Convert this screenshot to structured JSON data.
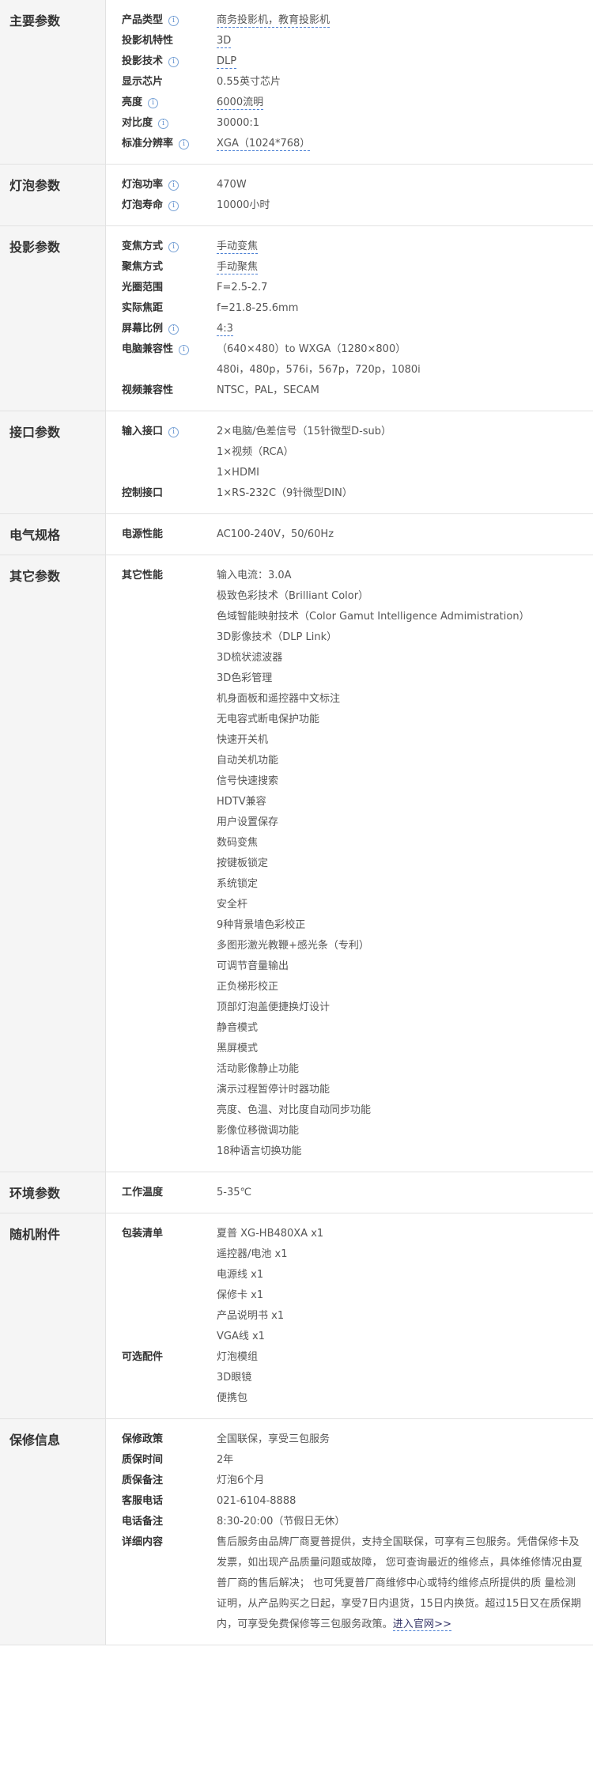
{
  "info_glyph": "i",
  "sections": [
    {
      "title": "主要参数",
      "rows": [
        {
          "label": "产品类型",
          "info": true,
          "values": [
            {
              "text": "商务投影机，教育投影机",
              "link": true
            }
          ]
        },
        {
          "label": "投影机特性",
          "info": false,
          "values": [
            {
              "text": "3D",
              "link": true
            }
          ]
        },
        {
          "label": "投影技术",
          "info": true,
          "values": [
            {
              "text": "DLP",
              "link": true
            }
          ]
        },
        {
          "label": "显示芯片",
          "info": false,
          "values": [
            {
              "text": "0.55英寸芯片",
              "link": false
            }
          ]
        },
        {
          "label": "亮度",
          "info": true,
          "values": [
            {
              "text": "6000流明",
              "link": true
            }
          ]
        },
        {
          "label": "对比度",
          "info": true,
          "values": [
            {
              "text": "30000:1",
              "link": false
            }
          ]
        },
        {
          "label": "标准分辨率",
          "info": true,
          "values": [
            {
              "text": "XGA（1024*768）",
              "link": true
            }
          ]
        }
      ]
    },
    {
      "title": "灯泡参数",
      "rows": [
        {
          "label": "灯泡功率",
          "info": true,
          "values": [
            {
              "text": "470W",
              "link": false
            }
          ]
        },
        {
          "label": "灯泡寿命",
          "info": true,
          "values": [
            {
              "text": "10000小时",
              "link": false
            }
          ]
        }
      ]
    },
    {
      "title": "投影参数",
      "rows": [
        {
          "label": "变焦方式",
          "info": true,
          "values": [
            {
              "text": "手动变焦",
              "link": true
            }
          ]
        },
        {
          "label": "聚焦方式",
          "info": false,
          "values": [
            {
              "text": "手动聚焦",
              "link": true
            }
          ]
        },
        {
          "label": "光圈范围",
          "info": false,
          "values": [
            {
              "text": "F=2.5-2.7",
              "link": false
            }
          ]
        },
        {
          "label": "实际焦距",
          "info": false,
          "values": [
            {
              "text": "f=21.8-25.6mm",
              "link": false
            }
          ]
        },
        {
          "label": "屏幕比例",
          "info": true,
          "values": [
            {
              "text": "4:3",
              "link": true
            }
          ]
        },
        {
          "label": "电脑兼容性",
          "info": true,
          "values": [
            {
              "text": "（640×480）to WXGA（1280×800）",
              "link": false
            },
            {
              "text": "480i，480p，576i，567p，720p，1080i",
              "link": false
            }
          ]
        },
        {
          "label": "视频兼容性",
          "info": false,
          "values": [
            {
              "text": "NTSC，PAL，SECAM",
              "link": false
            }
          ]
        }
      ]
    },
    {
      "title": "接口参数",
      "rows": [
        {
          "label": "输入接口",
          "info": true,
          "values": [
            {
              "text": "2×电脑/色差信号（15针微型D-sub）",
              "link": false
            },
            {
              "text": "1×视频（RCA）",
              "link": false
            },
            {
              "text": "1×HDMI",
              "link": false
            }
          ]
        },
        {
          "label": "控制接口",
          "info": false,
          "values": [
            {
              "text": "1×RS-232C（9针微型DIN）",
              "link": false
            }
          ]
        }
      ]
    },
    {
      "title": "电气规格",
      "rows": [
        {
          "label": "电源性能",
          "info": false,
          "values": [
            {
              "text": "AC100-240V，50/60Hz",
              "link": false
            }
          ]
        }
      ]
    },
    {
      "title": "其它参数",
      "rows": [
        {
          "label": "其它性能",
          "info": false,
          "values": [
            {
              "text": "输入电流：3.0A",
              "link": false
            },
            {
              "text": "极致色彩技术（Brilliant Color）",
              "link": false
            },
            {
              "text": "色域智能映射技术（Color Gamut Intelligence Admimistration）",
              "link": false
            },
            {
              "text": "3D影像技术（DLP Link）",
              "link": false
            },
            {
              "text": "3D梳状滤波器",
              "link": false
            },
            {
              "text": "3D色彩管理",
              "link": false
            },
            {
              "text": "机身面板和遥控器中文标注",
              "link": false
            },
            {
              "text": "无电容式断电保护功能",
              "link": false
            },
            {
              "text": "快速开关机",
              "link": false
            },
            {
              "text": "自动关机功能",
              "link": false
            },
            {
              "text": "信号快速搜索",
              "link": false
            },
            {
              "text": "HDTV兼容",
              "link": false
            },
            {
              "text": "用户设置保存",
              "link": false
            },
            {
              "text": "数码变焦",
              "link": false
            },
            {
              "text": "按键板锁定",
              "link": false
            },
            {
              "text": "系统锁定",
              "link": false
            },
            {
              "text": "安全杆",
              "link": false
            },
            {
              "text": "9种背景墙色彩校正",
              "link": false
            },
            {
              "text": "多图形激光教鞭+感光条（专利）",
              "link": false
            },
            {
              "text": "可调节音量输出",
              "link": false
            },
            {
              "text": "正负梯形校正",
              "link": false
            },
            {
              "text": "顶部灯泡盖便捷换灯设计",
              "link": false
            },
            {
              "text": "静音模式",
              "link": false
            },
            {
              "text": "黑屏模式",
              "link": false
            },
            {
              "text": "活动影像静止功能",
              "link": false
            },
            {
              "text": "演示过程暂停计时器功能",
              "link": false
            },
            {
              "text": "亮度、色温、对比度自动同步功能",
              "link": false
            },
            {
              "text": "影像位移微调功能",
              "link": false
            },
            {
              "text": "18种语言切换功能",
              "link": false
            }
          ]
        }
      ]
    },
    {
      "title": "环境参数",
      "rows": [
        {
          "label": "工作温度",
          "info": false,
          "values": [
            {
              "text": "5-35℃",
              "link": false
            }
          ]
        }
      ]
    },
    {
      "title": "随机附件",
      "rows": [
        {
          "label": "包装清单",
          "info": false,
          "values": [
            {
              "text": "夏普 XG-HB480XA x1",
              "link": false
            },
            {
              "text": "遥控器/电池 x1",
              "link": false
            },
            {
              "text": "电源线 x1",
              "link": false
            },
            {
              "text": "保修卡 x1",
              "link": false
            },
            {
              "text": "产品说明书 x1",
              "link": false
            },
            {
              "text": "VGA线 x1",
              "link": false
            }
          ]
        },
        {
          "label": "可选配件",
          "info": false,
          "values": [
            {
              "text": "灯泡模组",
              "link": false
            },
            {
              "text": "3D眼镜",
              "link": false
            },
            {
              "text": "便携包",
              "link": false
            }
          ]
        }
      ]
    },
    {
      "title": "保修信息",
      "rows": [
        {
          "label": "保修政策",
          "info": false,
          "values": [
            {
              "text": "全国联保，享受三包服务",
              "link": false
            }
          ]
        },
        {
          "label": "质保时间",
          "info": false,
          "values": [
            {
              "text": "2年",
              "link": false
            }
          ]
        },
        {
          "label": "质保备注",
          "info": false,
          "values": [
            {
              "text": "灯泡6个月",
              "link": false
            }
          ]
        },
        {
          "label": "客服电话",
          "info": false,
          "values": [
            {
              "text": "021-6104-8888",
              "link": false
            }
          ]
        },
        {
          "label": "电话备注",
          "info": false,
          "values": [
            {
              "text": "8:30-20:00（节假日无休）",
              "link": false
            }
          ]
        },
        {
          "label": "详细内容",
          "info": false,
          "detail": true,
          "detail_text": "售后服务由品牌厂商夏普提供，支持全国联保，可享有三包服务。凭借保修卡及发票，如出现产品质量问题或故障， 您可查询最近的维修点，具体维修情况由夏普厂商的售后解决； 也可凭夏普厂商维修中心或特约维修点所提供的质 量检测证明，从产品购买之日起，享受7日内退货，15日内换货。超过15日又在质保期内，可享受免费保修等三包服务政策。",
          "more_link": "进入官网>>"
        }
      ]
    }
  ]
}
